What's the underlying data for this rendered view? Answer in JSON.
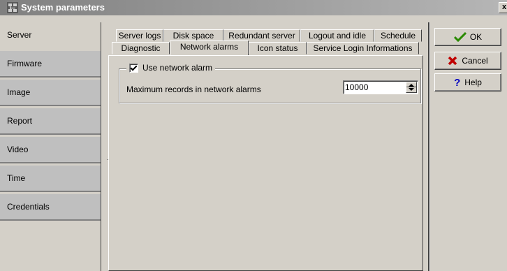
{
  "window": {
    "title": "System parameters",
    "close_glyph": "x"
  },
  "sidebar": {
    "items": [
      {
        "label": "Server",
        "active": true
      },
      {
        "label": "Firmware",
        "active": false
      },
      {
        "label": "Image",
        "active": false
      },
      {
        "label": "Report",
        "active": false
      },
      {
        "label": "Video",
        "active": false
      },
      {
        "label": "Time",
        "active": false
      },
      {
        "label": "Credentials",
        "active": false
      }
    ]
  },
  "tabs": {
    "row1": [
      "Server logs",
      "Disk space",
      "Redundant server",
      "Logout and idle",
      "Schedule"
    ],
    "row2": [
      "Diagnostic",
      "Network alarms",
      "Icon status",
      "Service Login Informations"
    ],
    "active": "Network alarms"
  },
  "panel": {
    "group_title": "Use network alarm",
    "use_network_alarm_checked": true,
    "max_records_label": "Maximum records in network alarms",
    "max_records_value": "10000"
  },
  "buttons": {
    "ok": {
      "label": "OK",
      "icon": "check-icon",
      "color": "#2a8a00"
    },
    "cancel": {
      "label": "Cancel",
      "icon": "x-icon",
      "color": "#c00000"
    },
    "help": {
      "label": "Help",
      "icon": "question-icon",
      "color": "#0000c0"
    }
  }
}
